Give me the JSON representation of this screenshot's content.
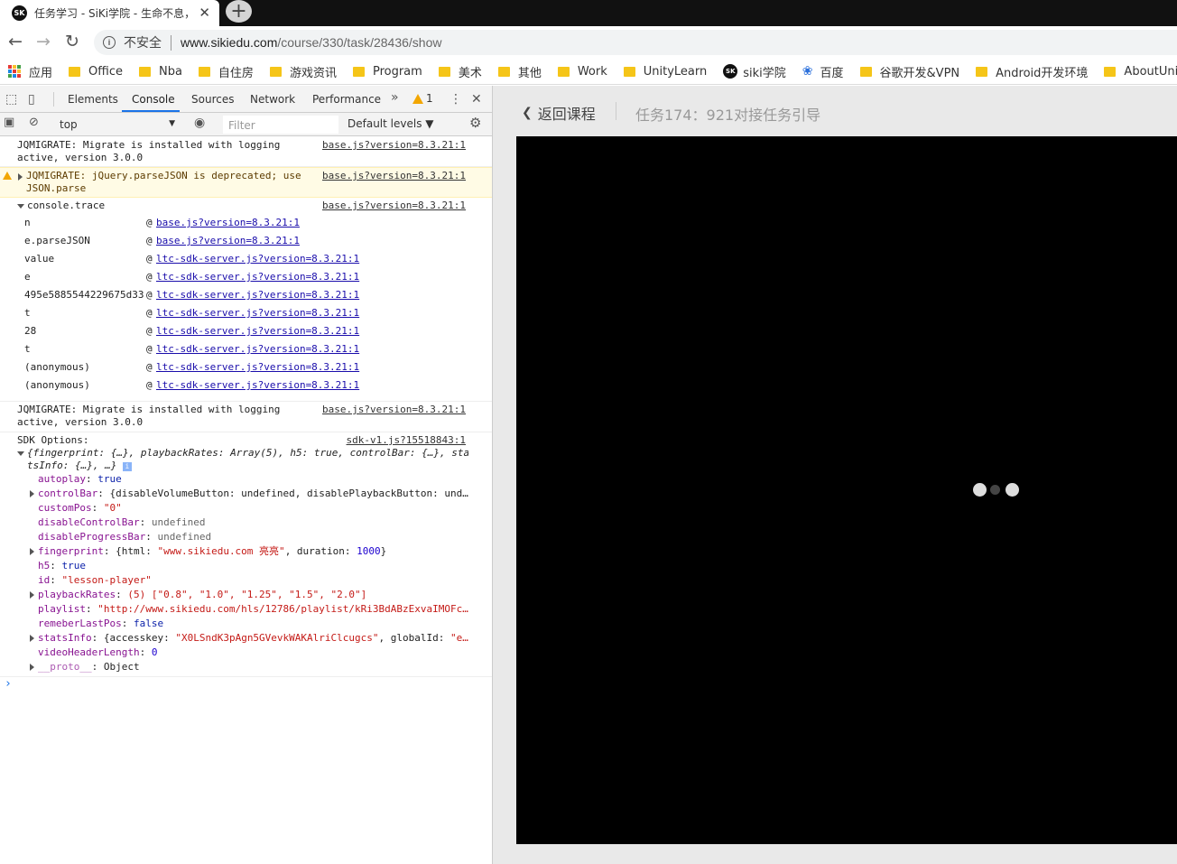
{
  "browser": {
    "tab_title": "任务学习 - SiKi学院 - 生命不息，",
    "tab_favicon": "SK",
    "tab_close": "✕",
    "new_tab": "+",
    "security_label": "不安全",
    "url_host": "www.sikiedu.com",
    "url_path": "/course/330/task/28436/show",
    "bookmarks": [
      {
        "label": "应用",
        "icon": "apps-icon"
      },
      {
        "label": "Office",
        "icon": "folder-icon"
      },
      {
        "label": "Nba",
        "icon": "folder-icon"
      },
      {
        "label": "自住房",
        "icon": "folder-icon"
      },
      {
        "label": "游戏资讯",
        "icon": "folder-icon"
      },
      {
        "label": "Program",
        "icon": "folder-icon"
      },
      {
        "label": "美术",
        "icon": "folder-icon"
      },
      {
        "label": "其他",
        "icon": "folder-icon"
      },
      {
        "label": "Work",
        "icon": "folder-icon"
      },
      {
        "label": "UnityLearn",
        "icon": "folder-icon"
      },
      {
        "label": "siki学院",
        "icon": "sk-icon"
      },
      {
        "label": "百度",
        "icon": "paw-icon"
      },
      {
        "label": "谷歌开发&VPN",
        "icon": "folder-icon"
      },
      {
        "label": "Android开发环境",
        "icon": "folder-icon"
      },
      {
        "label": "AboutUnity",
        "icon": "folder-icon"
      }
    ]
  },
  "devtools": {
    "tabs": [
      "Elements",
      "Console",
      "Sources",
      "Network",
      "Performance"
    ],
    "active_tab": "Console",
    "more_tabs": "»",
    "warning_count": "1",
    "context": "top",
    "filter_placeholder": "Filter",
    "levels": "Default levels ▼",
    "messages": {
      "m1": {
        "text": "JQMIGRATE: Migrate is installed with logging\nactive, version 3.0.0",
        "source": "base.js?version=8.3.21:1"
      },
      "m2": {
        "text": "JQMIGRATE: jQuery.parseJSON is deprecated; use\nJSON.parse",
        "source": "base.js?version=8.3.21:1"
      },
      "m3": {
        "text": "console.trace",
        "source": "base.js?version=8.3.21:1"
      },
      "m4": {
        "text": "JQMIGRATE: Migrate is installed with logging\nactive, version 3.0.0",
        "source": "base.js?version=8.3.21:1"
      },
      "m5": {
        "text": "SDK Options:",
        "source": "sdk-v1.js?15518843:1"
      }
    },
    "trace": [
      {
        "fn": "n",
        "link": "base.js?version=8.3.21:1"
      },
      {
        "fn": "e.parseJSON",
        "link": "base.js?version=8.3.21:1"
      },
      {
        "fn": "value",
        "link": "ltc-sdk-server.js?version=8.3.21:1"
      },
      {
        "fn": "e",
        "link": "ltc-sdk-server.js?version=8.3.21:1"
      },
      {
        "fn": "495e5885544229675d33",
        "link": "ltc-sdk-server.js?version=8.3.21:1"
      },
      {
        "fn": "t",
        "link": "ltc-sdk-server.js?version=8.3.21:1"
      },
      {
        "fn": "28",
        "link": "ltc-sdk-server.js?version=8.3.21:1"
      },
      {
        "fn": "t",
        "link": "ltc-sdk-server.js?version=8.3.21:1"
      },
      {
        "fn": "(anonymous)",
        "link": "ltc-sdk-server.js?version=8.3.21:1"
      },
      {
        "fn": "(anonymous)",
        "link": "ltc-sdk-server.js?version=8.3.21:1"
      }
    ],
    "sdk_preview_1": "{fingerprint: {…}, playbackRates: Array(5), h5: true, controlBar: {…}, sta",
    "sdk_preview_2": "tsInfo: {…}, …}",
    "props": {
      "autoplay": {
        "key": "autoplay",
        "val": "true"
      },
      "controlBar": {
        "key": "controlBar",
        "val": "{disableVolumeButton: undefined, disablePlaybackButton: und…"
      },
      "customPos": {
        "key": "customPos",
        "val": "\"0\""
      },
      "disableControlBar": {
        "key": "disableControlBar",
        "val": "undefined"
      },
      "disableProgressBar": {
        "key": "disableProgressBar",
        "val": "undefined"
      },
      "fingerprint_k": "fingerprint",
      "fingerprint_a": "{html: ",
      "fingerprint_s": "\"www.sikiedu.com 亮亮\"",
      "fingerprint_b": ", duration: ",
      "fingerprint_n": "1000",
      "fingerprint_c": "}",
      "h5": {
        "key": "h5",
        "val": "true"
      },
      "id": {
        "key": "id",
        "val": "\"lesson-player\""
      },
      "playbackRates_k": "playbackRates",
      "playbackRates_v": "(5) [\"0.8\", \"1.0\", \"1.25\", \"1.5\", \"2.0\"]",
      "playlist": {
        "key": "playlist",
        "val": "\"http://www.sikiedu.com/hls/12786/playlist/kRi3BdABzExvaIMOFc…"
      },
      "remeberLastPos": {
        "key": "remeberLastPos",
        "val": "false"
      },
      "statsInfo_k": "statsInfo",
      "statsInfo_a": "{accesskey: ",
      "statsInfo_s": "\"X0LSndK3pAgn5GVevkWAKAlriClcugcs\"",
      "statsInfo_b": ", globalId: ",
      "statsInfo_s2": "\"e…",
      "videoHeaderLength": {
        "key": "videoHeaderLength",
        "val": "0"
      },
      "proto": {
        "key": "__proto__",
        "val": "Object"
      }
    },
    "prompt": "›"
  },
  "page": {
    "back_label": "返回课程",
    "task_title": "任务174：921对接任务引导"
  },
  "colors": {
    "accent": "#1a73e8",
    "warning": "#f2a600",
    "player_bg": "#000000",
    "page_bg": "#e9e9e9"
  }
}
